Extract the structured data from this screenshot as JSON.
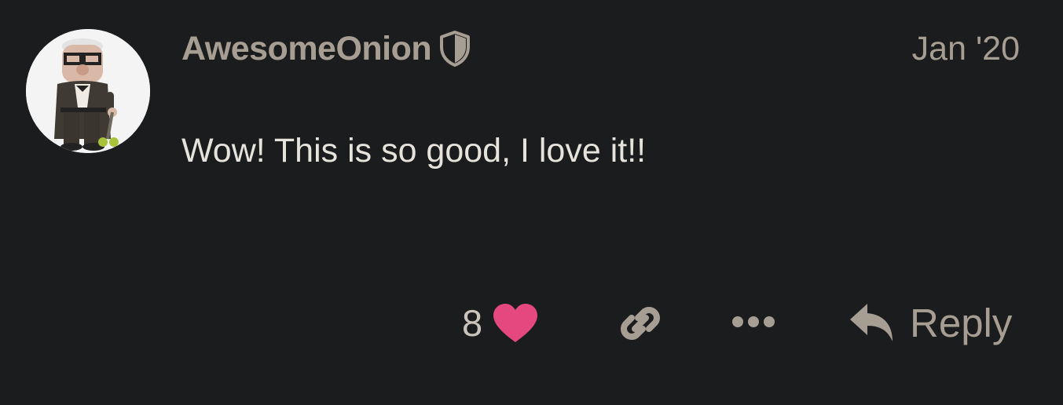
{
  "post": {
    "author": "AwesomeOnion",
    "date": "Jan '20",
    "body": "Wow! This is so good, I love it!!",
    "avatar_icon": "user-avatar",
    "author_badge_icon": "shield-icon"
  },
  "actions": {
    "like_count": "8",
    "like_icon": "heart-icon",
    "link_icon": "link-icon",
    "more_icon": "ellipsis-icon",
    "reply_label": "Reply",
    "reply_icon": "reply-arrow-icon"
  },
  "colors": {
    "background": "#1b1c1e",
    "meta_text": "#a69e93",
    "body_text": "#e6e2dc",
    "heart": "#e4487e"
  }
}
